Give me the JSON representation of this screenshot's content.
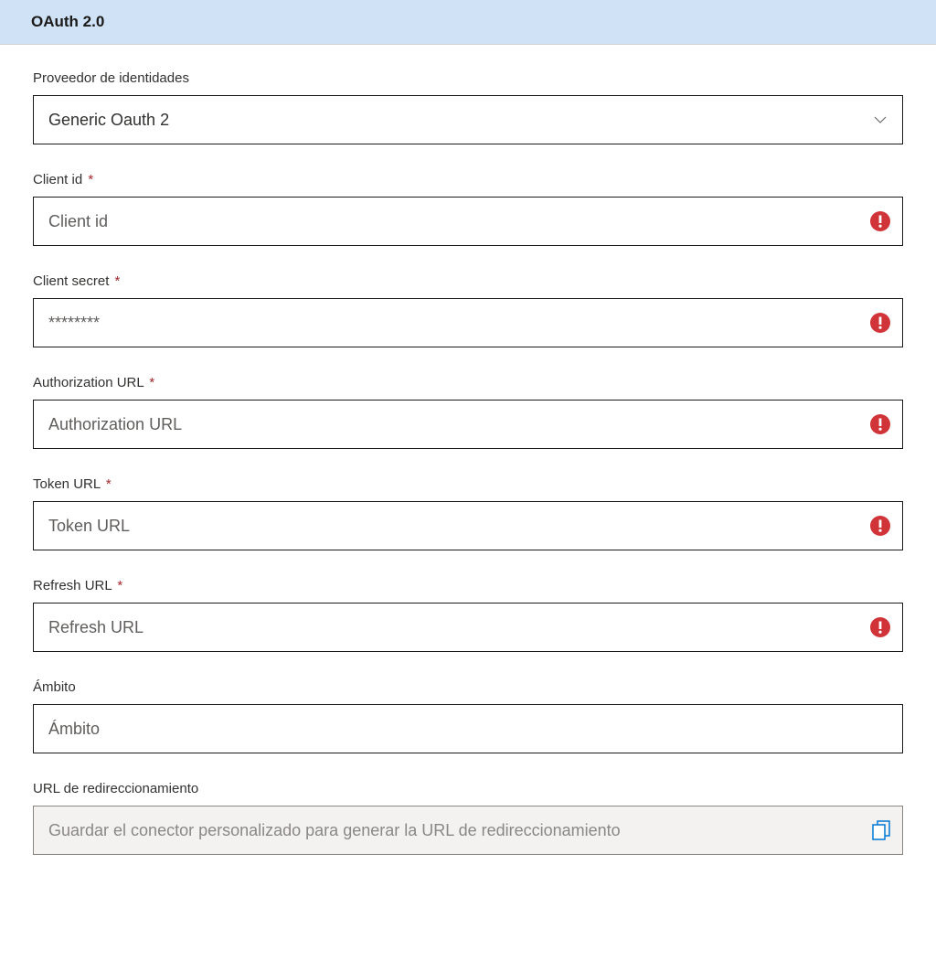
{
  "header": {
    "title": "OAuth 2.0"
  },
  "fields": {
    "identityProvider": {
      "label": "Proveedor de identidades",
      "value": "Generic Oauth 2"
    },
    "clientId": {
      "label": "Client id",
      "placeholder": "Client id",
      "required": "*"
    },
    "clientSecret": {
      "label": "Client secret",
      "placeholder": "********",
      "required": "*"
    },
    "authorizationUrl": {
      "label": "Authorization URL",
      "placeholder": "Authorization URL",
      "required": "*"
    },
    "tokenUrl": {
      "label": "Token URL",
      "placeholder": "Token URL",
      "required": "*"
    },
    "refreshUrl": {
      "label": "Refresh URL",
      "placeholder": "Refresh URL",
      "required": "*"
    },
    "scope": {
      "label": "Ámbito",
      "placeholder": "Ámbito"
    },
    "redirectUrl": {
      "label": "URL de redireccionamiento",
      "value": "Guardar el conector personalizado para generar la URL de redireccionamiento"
    }
  }
}
